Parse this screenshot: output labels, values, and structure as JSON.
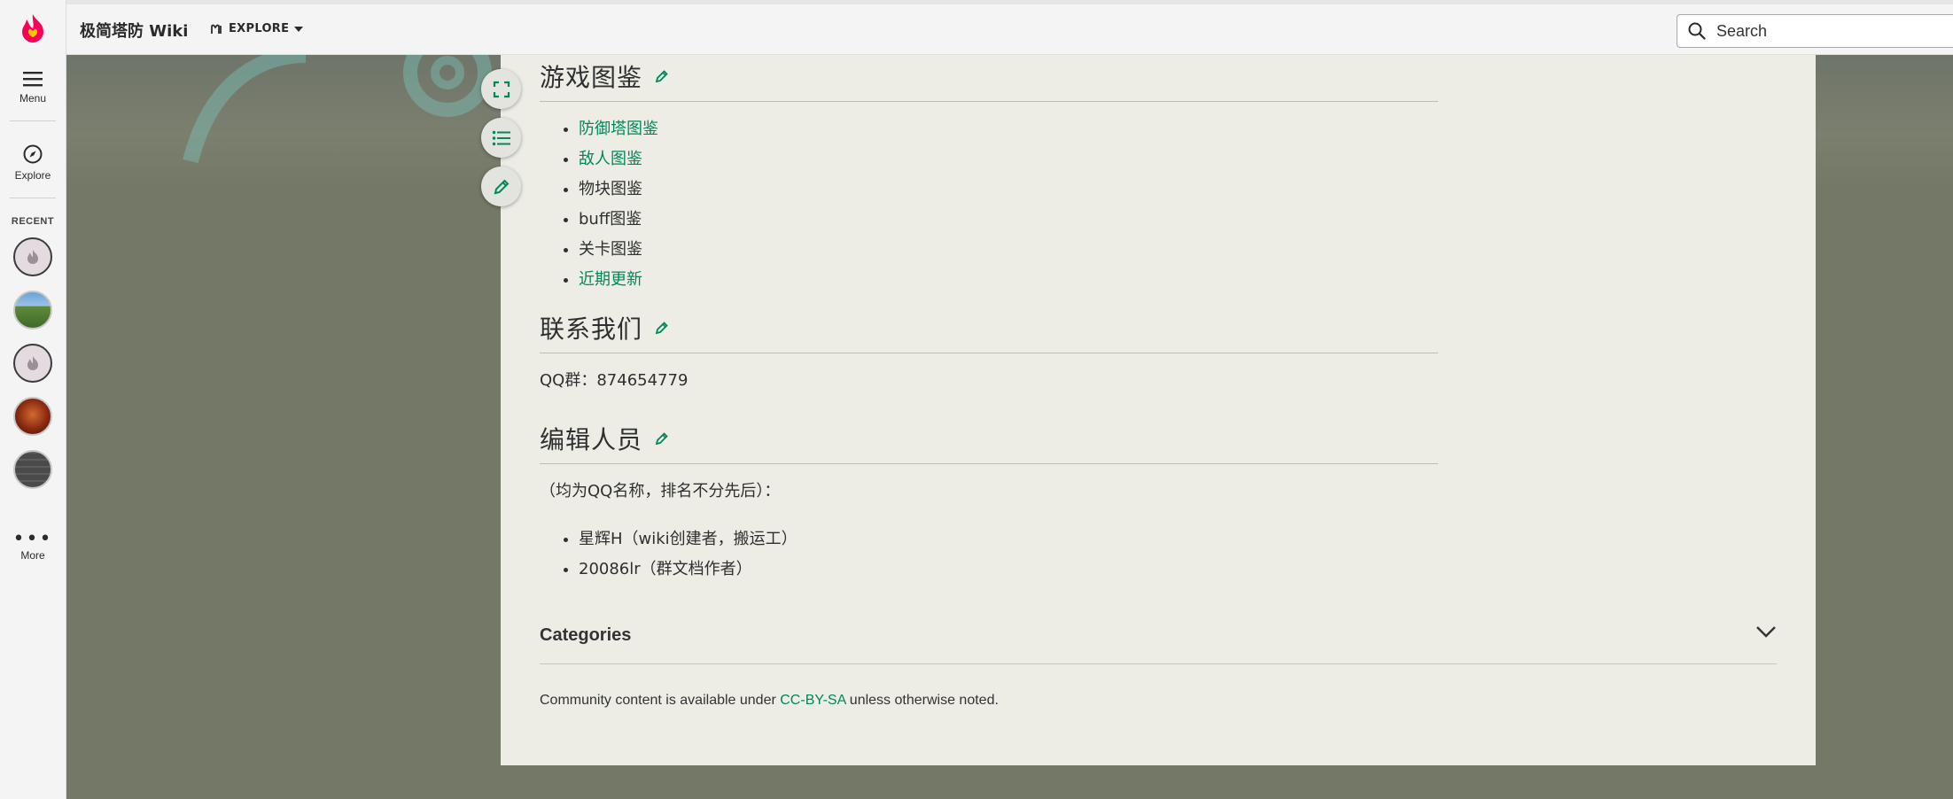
{
  "colors": {
    "accent": "#00875a",
    "brand": "#fa005a",
    "background": "#747866",
    "card": "#edede6"
  },
  "rail": {
    "menu_label": "Menu",
    "explore_label": "Explore",
    "recent_label": "RECENT",
    "recent_icons": [
      "fandom-flame-icon",
      "nature-thumbnail",
      "fandom-flame-icon",
      "red-thumbnail",
      "brick-thumbnail"
    ],
    "more_label": "More"
  },
  "topbar": {
    "wiki_name": "极简塔防 Wiki",
    "explore_label": "EXPLORE",
    "search_placeholder": "Search"
  },
  "sections": [
    {
      "title": "游戏图鉴",
      "items": [
        {
          "label": "防御塔图鉴",
          "link": true
        },
        {
          "label": "敌人图鉴",
          "link": true
        },
        {
          "label": "物块图鉴",
          "link": false
        },
        {
          "label": "buff图鉴",
          "link": false
        },
        {
          "label": "关卡图鉴",
          "link": false
        },
        {
          "label": "近期更新",
          "link": true
        }
      ]
    },
    {
      "title": "联系我们",
      "text": "QQ群：874654779"
    },
    {
      "title": "编辑人员",
      "text": "（均为QQ名称，排名不分先后）：",
      "items": [
        {
          "label": "星辉H（wiki创建者，搬运工）",
          "link": false
        },
        {
          "label": "20086lr（群文档作者）",
          "link": false
        }
      ]
    }
  ],
  "categories_label": "Categories",
  "footer": {
    "prefix": "Community content is available under ",
    "license": "CC-BY-SA",
    "suffix": " unless otherwise noted."
  }
}
